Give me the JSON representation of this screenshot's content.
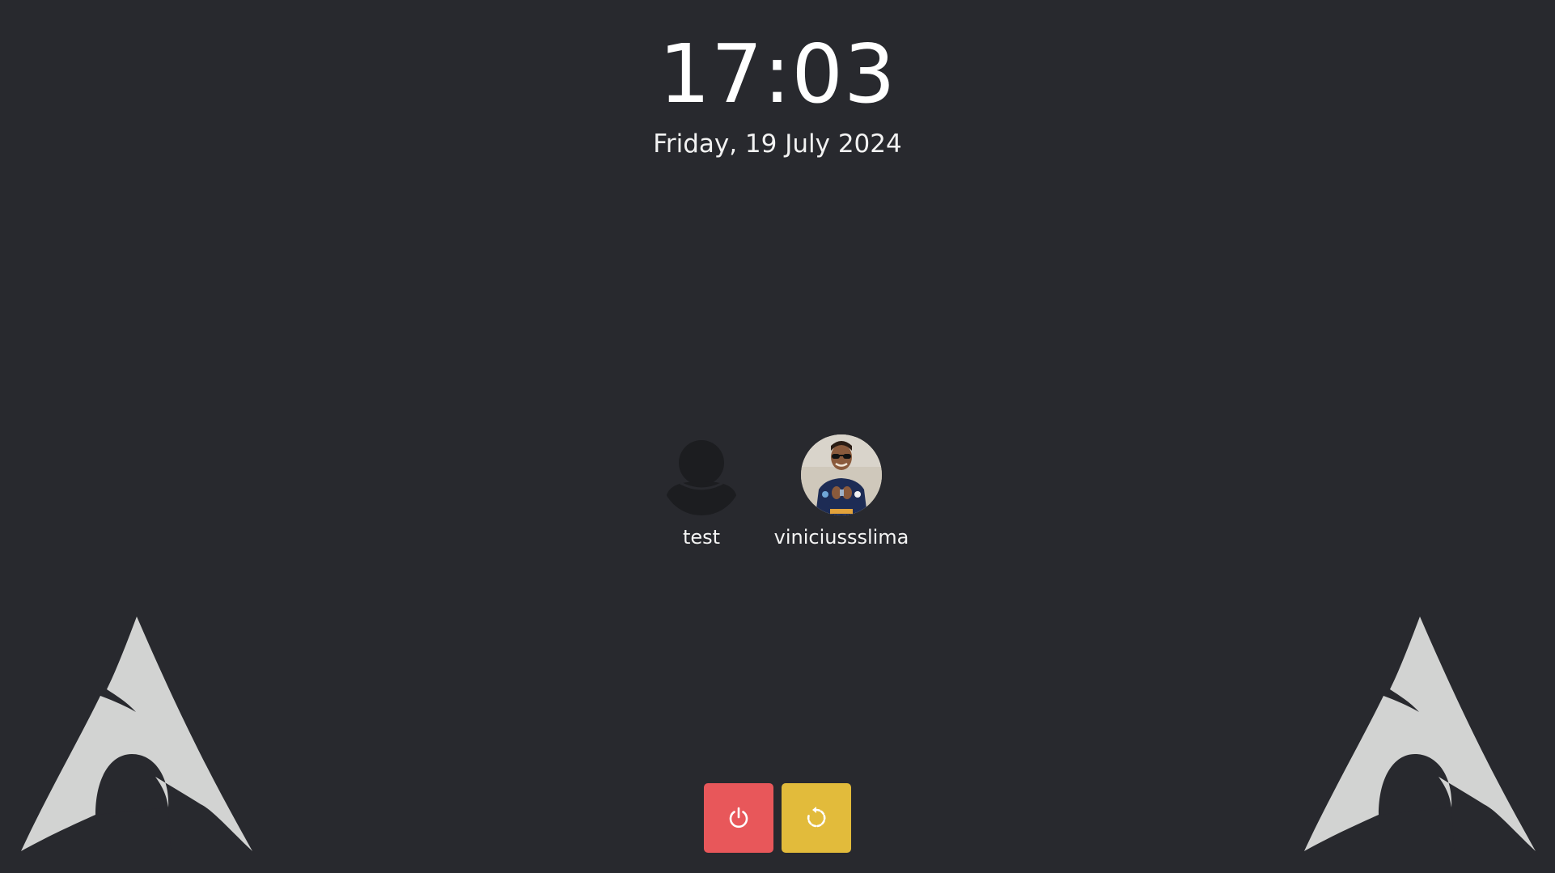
{
  "clock": {
    "time": "17:03",
    "date": "Friday, 19 July 2024"
  },
  "users": [
    {
      "name": "test",
      "avatar": "generic-user-icon"
    },
    {
      "name": "viniciussslima",
      "avatar": "user-photo"
    }
  ],
  "power": {
    "shutdown_icon": "power-icon",
    "reboot_icon": "reboot-icon"
  },
  "colors": {
    "background": "#28292e",
    "shutdown": "#e8575a",
    "reboot": "#e2bb3b",
    "logo": "#d2d3d2"
  }
}
